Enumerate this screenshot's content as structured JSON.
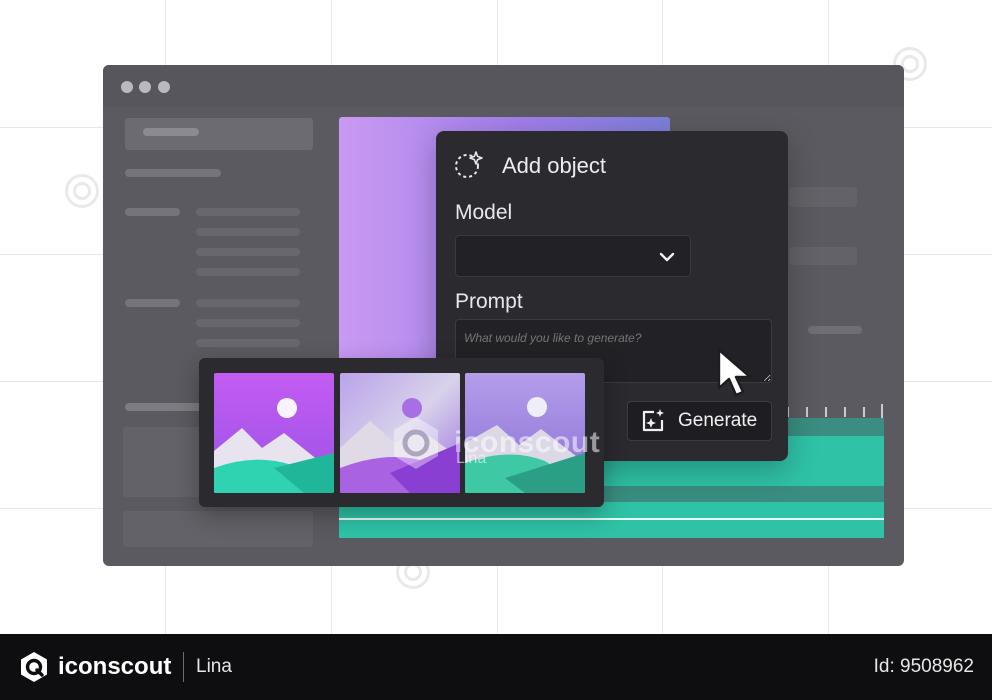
{
  "panel": {
    "title": "Add object",
    "model_label": "Model",
    "model_value": "",
    "prompt_label": "Prompt",
    "prompt_placeholder": "What would you like to generate?",
    "generate_label": "Generate"
  },
  "thumbnails": [
    {
      "name": "image option 1"
    },
    {
      "name": "image option 2"
    },
    {
      "name": "image option 3"
    }
  ],
  "watermark": {
    "brand": "iconscout",
    "author": "Lina"
  },
  "footer": {
    "brand": "iconscout",
    "author": "Lina",
    "id_text": "Id: 9508962"
  },
  "colors": {
    "accent_teal": "#2fc2a6",
    "accent_purple": "#a07ee8",
    "panel_bg": "#2a2a2f",
    "window_bg": "#5a5a60"
  },
  "icons": [
    "sparkle-icon",
    "chevron-down-icon",
    "ai-image-icon",
    "cursor-icon",
    "iconscout-logo-icon"
  ]
}
